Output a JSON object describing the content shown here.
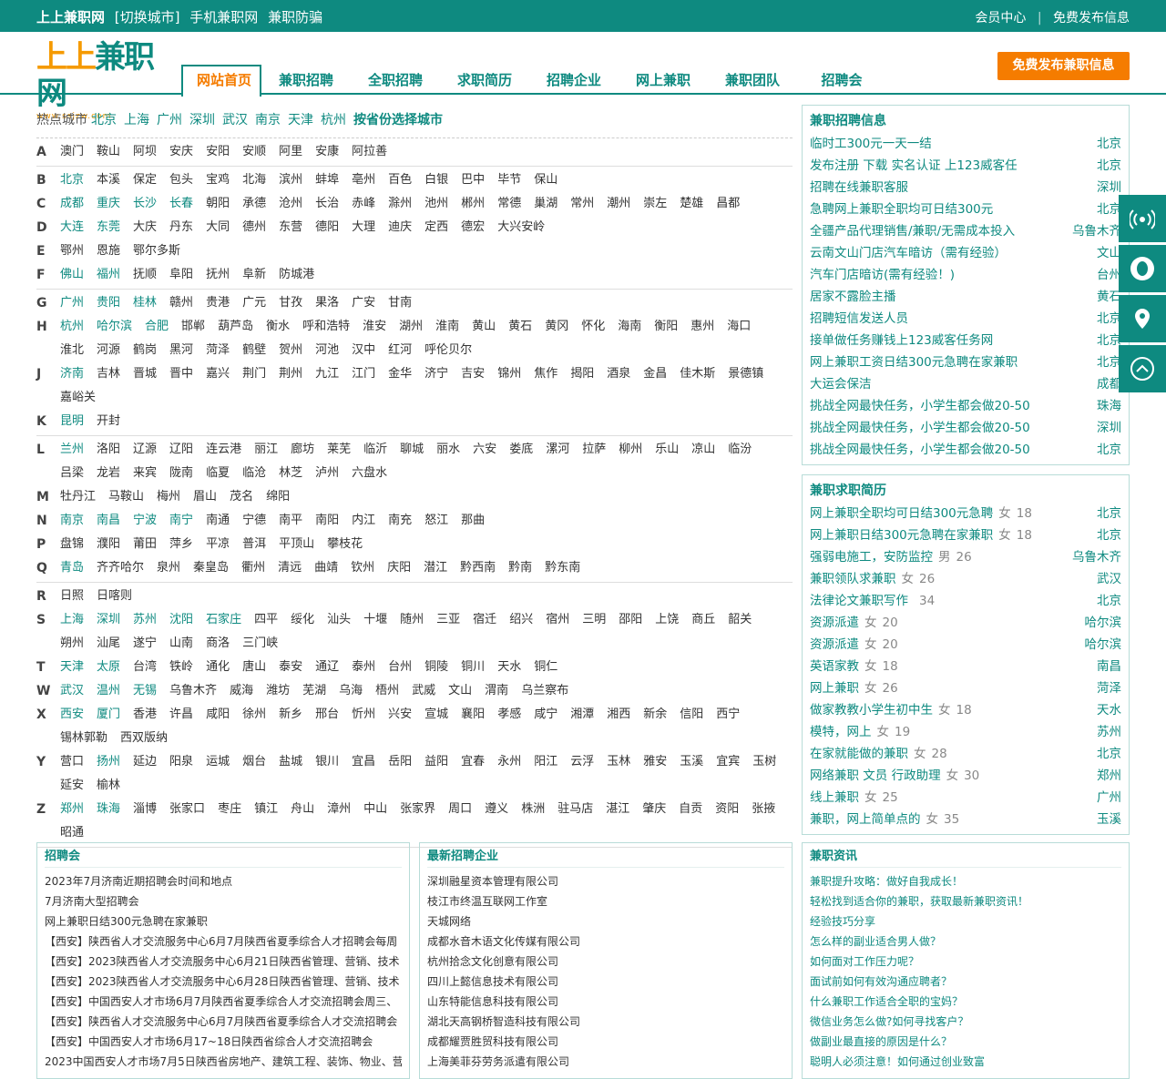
{
  "topbar": {
    "site": "上上兼职网",
    "switch": "[切换城市]",
    "mobile": "手机兼职网",
    "anti": "兼职防骗",
    "member": "会员中心",
    "sep": "|",
    "publish": "免费发布信息"
  },
  "logo": {
    "text_a": "上",
    "text_b": "上",
    "text_c": "兼职网",
    "url": "www.ssjzw.com"
  },
  "nav": [
    "网站首页",
    "兼职招聘",
    "全职招聘",
    "求职简历",
    "招聘企业",
    "网上兼职",
    "兼职团队",
    "招聘会"
  ],
  "publish_button": "免费发布兼职信息",
  "hot": {
    "label": "热点城市",
    "cities": [
      "北京",
      "上海",
      "广州",
      "深圳",
      "武汉",
      "南京",
      "天津",
      "杭州"
    ],
    "province": "按省份选择城市"
  },
  "groups": [
    [
      {
        "L": "A",
        "cities": [
          "澳门",
          "鞍山",
          "阿坝",
          "安庆",
          "安阳",
          "安顺",
          "阿里",
          "安康",
          "阿拉善"
        ],
        "hl": 0
      }
    ],
    [
      {
        "L": "B",
        "cities": [
          "北京",
          "本溪",
          "保定",
          "包头",
          "宝鸡",
          "北海",
          "滨州",
          "蚌埠",
          "亳州",
          "百色",
          "白银",
          "巴中",
          "毕节",
          "保山"
        ],
        "hl": 1
      },
      {
        "L": "C",
        "cities": [
          "成都",
          "重庆",
          "长沙",
          "长春",
          "朝阳",
          "承德",
          "沧州",
          "长治",
          "赤峰",
          "滁州",
          "池州",
          "郴州",
          "常德",
          "巢湖",
          "常州",
          "潮州",
          "崇左",
          "楚雄",
          "昌都"
        ],
        "hl": 4
      },
      {
        "L": "D",
        "cities": [
          "大连",
          "东莞",
          "大庆",
          "丹东",
          "大同",
          "德州",
          "东营",
          "德阳",
          "大理",
          "迪庆",
          "定西",
          "德宏",
          "大兴安岭"
        ],
        "hl": 2
      },
      {
        "L": "E",
        "cities": [
          "鄂州",
          "恩施",
          "鄂尔多斯"
        ],
        "hl": 0
      },
      {
        "L": "F",
        "cities": [
          "佛山",
          "福州",
          "抚顺",
          "阜阳",
          "抚州",
          "阜新",
          "防城港"
        ],
        "hl": 2
      }
    ],
    [
      {
        "L": "G",
        "cities": [
          "广州",
          "贵阳",
          "桂林",
          "赣州",
          "贵港",
          "广元",
          "甘孜",
          "果洛",
          "广安",
          "甘南"
        ],
        "hl": 3
      },
      {
        "L": "H",
        "cities": [
          "杭州",
          "哈尔滨",
          "合肥",
          "邯郸",
          "葫芦岛",
          "衡水",
          "呼和浩特",
          "淮安",
          "湖州",
          "淮南",
          "黄山",
          "黄石",
          "黄冈",
          "怀化",
          "海南",
          "衡阳",
          "惠州",
          "海口",
          "淮北",
          "河源",
          "鹤岗",
          "黑河",
          "菏泽",
          "鹤壁",
          "贺州",
          "河池",
          "汉中",
          "红河",
          "呼伦贝尔"
        ],
        "hl": 3
      },
      {
        "L": "J",
        "cities": [
          "济南",
          "吉林",
          "晋城",
          "晋中",
          "嘉兴",
          "荆门",
          "荆州",
          "九江",
          "江门",
          "金华",
          "济宁",
          "吉安",
          "锦州",
          "焦作",
          "揭阳",
          "酒泉",
          "金昌",
          "佳木斯",
          "景德镇",
          "嘉峪关"
        ],
        "hl": 1
      },
      {
        "L": "K",
        "cities": [
          "昆明",
          "开封"
        ],
        "hl": 1
      }
    ],
    [
      {
        "L": "L",
        "cities": [
          "兰州",
          "洛阳",
          "辽源",
          "辽阳",
          "连云港",
          "丽江",
          "廊坊",
          "莱芜",
          "临沂",
          "聊城",
          "丽水",
          "六安",
          "娄底",
          "漯河",
          "拉萨",
          "柳州",
          "乐山",
          "凉山",
          "临汾",
          "吕梁",
          "龙岩",
          "来宾",
          "陇南",
          "临夏",
          "临沧",
          "林芝",
          "泸州",
          "六盘水"
        ],
        "hl": 1
      },
      {
        "L": "M",
        "cities": [
          "牡丹江",
          "马鞍山",
          "梅州",
          "眉山",
          "茂名",
          "绵阳"
        ],
        "hl": 0
      },
      {
        "L": "N",
        "cities": [
          "南京",
          "南昌",
          "宁波",
          "南宁",
          "南通",
          "宁德",
          "南平",
          "南阳",
          "内江",
          "南充",
          "怒江",
          "那曲"
        ],
        "hl": 4
      },
      {
        "L": "P",
        "cities": [
          "盘锦",
          "濮阳",
          "莆田",
          "萍乡",
          "平凉",
          "普洱",
          "平顶山",
          "攀枝花"
        ],
        "hl": 0
      },
      {
        "L": "Q",
        "cities": [
          "青岛",
          "齐齐哈尔",
          "泉州",
          "秦皇岛",
          "衢州",
          "清远",
          "曲靖",
          "钦州",
          "庆阳",
          "潜江",
          "黔西南",
          "黔南",
          "黔东南"
        ],
        "hl": 1
      }
    ],
    [
      {
        "L": "R",
        "cities": [
          "日照",
          "日喀则"
        ],
        "hl": 0
      },
      {
        "L": "S",
        "cities": [
          "上海",
          "深圳",
          "苏州",
          "沈阳",
          "石家庄",
          "四平",
          "绥化",
          "汕头",
          "十堰",
          "随州",
          "三亚",
          "宿迁",
          "绍兴",
          "宿州",
          "三明",
          "邵阳",
          "上饶",
          "商丘",
          "韶关",
          "朔州",
          "汕尾",
          "遂宁",
          "山南",
          "商洛",
          "三门峡"
        ],
        "hl": 5
      },
      {
        "L": "T",
        "cities": [
          "天津",
          "太原",
          "台湾",
          "铁岭",
          "通化",
          "唐山",
          "泰安",
          "通辽",
          "泰州",
          "台州",
          "铜陵",
          "铜川",
          "天水",
          "铜仁"
        ],
        "hl": 2
      },
      {
        "L": "W",
        "cities": [
          "武汉",
          "温州",
          "无锡",
          "乌鲁木齐",
          "威海",
          "潍坊",
          "芜湖",
          "乌海",
          "梧州",
          "武威",
          "文山",
          "渭南",
          "乌兰察布"
        ],
        "hl": 3
      },
      {
        "L": "X",
        "cities": [
          "西安",
          "厦门",
          "香港",
          "许昌",
          "咸阳",
          "徐州",
          "新乡",
          "邢台",
          "忻州",
          "兴安",
          "宣城",
          "襄阳",
          "孝感",
          "咸宁",
          "湘潭",
          "湘西",
          "新余",
          "信阳",
          "西宁",
          "锡林郭勒",
          "西双版纳"
        ],
        "hl": 2
      },
      {
        "L": "Y",
        "cities": [
          "营口",
          "扬州",
          "延边",
          "阳泉",
          "运城",
          "烟台",
          "盐城",
          "银川",
          "宜昌",
          "岳阳",
          "益阳",
          "宜春",
          "永州",
          "阳江",
          "云浮",
          "玉林",
          "雅安",
          "玉溪",
          "宜宾",
          "玉树",
          "延安",
          "榆林"
        ],
        "hl": 0,
        "hlset": [
          1
        ]
      },
      {
        "L": "Z",
        "cities": [
          "郑州",
          "珠海",
          "淄博",
          "张家口",
          "枣庄",
          "镇江",
          "舟山",
          "漳州",
          "中山",
          "张家界",
          "周口",
          "遵义",
          "株洲",
          "驻马店",
          "湛江",
          "肇庆",
          "自贡",
          "资阳",
          "张掖",
          "昭通"
        ],
        "hl": 2
      }
    ]
  ],
  "jobs": {
    "title": "兼职招聘信息",
    "items": [
      {
        "t": "临时工300元一天一结",
        "c": "北京"
      },
      {
        "t": "发布注册 下载 实名认证 上123威客任",
        "c": "北京"
      },
      {
        "t": "招聘在线兼职客服",
        "c": "深圳"
      },
      {
        "t": "急聘网上兼职全职均可日结300元",
        "c": "北京"
      },
      {
        "t": "全疆产品代理销售/兼职/无需成本投入",
        "c": "乌鲁木齐"
      },
      {
        "t": "云南文山门店汽车暗访（需有经验）",
        "c": "文山"
      },
      {
        "t": "汽车门店暗访(需有经验！)",
        "c": "台州"
      },
      {
        "t": "居家不露脸主播",
        "c": "黄石"
      },
      {
        "t": "招聘短信发送人员",
        "c": "北京"
      },
      {
        "t": "接单做任务赚钱上123威客任务网",
        "c": "北京"
      },
      {
        "t": "网上兼职工资日结300元急聘在家兼职",
        "c": "北京"
      },
      {
        "t": "大运会保洁",
        "c": "成都"
      },
      {
        "t": "挑战全网最快任务，小学生都会做20-50",
        "c": "珠海"
      },
      {
        "t": "挑战全网最快任务，小学生都会做20-50",
        "c": "深圳"
      },
      {
        "t": "挑战全网最快任务，小学生都会做20-50",
        "c": "北京"
      }
    ]
  },
  "resumes": {
    "title": "兼职求职简历",
    "items": [
      {
        "t": "网上兼职全职均可日结300元急聘",
        "g": "女",
        "a": "18",
        "c": "北京"
      },
      {
        "t": "网上兼职日结300元急聘在家兼职",
        "g": "女",
        "a": "18",
        "c": "北京"
      },
      {
        "t": "强弱电施工，安防监控",
        "g": "男",
        "a": "26",
        "c": "乌鲁木齐"
      },
      {
        "t": "兼职领队求兼职",
        "g": "女",
        "a": "26",
        "c": "武汉"
      },
      {
        "t": "法律论文兼职写作",
        "g": "",
        "a": "34",
        "c": "北京"
      },
      {
        "t": "资源派遣",
        "g": "女",
        "a": "20",
        "c": "哈尔滨"
      },
      {
        "t": "资源派遣",
        "g": "女",
        "a": "20",
        "c": "哈尔滨"
      },
      {
        "t": "英语家教",
        "g": "女",
        "a": "18",
        "c": "南昌"
      },
      {
        "t": "网上兼职",
        "g": "女",
        "a": "26",
        "c": "菏泽"
      },
      {
        "t": "做家教教小学生初中生",
        "g": "女",
        "a": "18",
        "c": "天水"
      },
      {
        "t": "模特，网上",
        "g": "女",
        "a": "19",
        "c": "苏州"
      },
      {
        "t": "在家就能做的兼职",
        "g": "女",
        "a": "28",
        "c": "北京"
      },
      {
        "t": "网络兼职 文员 行政助理",
        "g": "女",
        "a": "30",
        "c": "郑州"
      },
      {
        "t": "线上兼职",
        "g": "女",
        "a": "25",
        "c": "广州"
      },
      {
        "t": "兼职，网上简单点的",
        "g": "女",
        "a": "35",
        "c": "玉溪"
      }
    ]
  },
  "fairs": {
    "title": "招聘会",
    "items": [
      "2023年7月济南近期招聘会时间和地点",
      "7月济南大型招聘会",
      "网上兼职日结300元急聘在家兼职",
      "【西安】陕西省人才交流服务中心6月7月陕西省夏季综合人才招聘会每周",
      "【西安】2023陕西省人才交流服务中心6月21日陕西省管理、营销、技术",
      "【西安】2023陕西省人才交流服务中心6月28日陕西省管理、营销、技术",
      "【西安】中国西安人才市场6月7月陕西省夏季综合人才交流招聘会周三、",
      "【西安】陕西省人才交流服务中心6月7月陕西省夏季综合人才交流招聘会",
      "【西安】中国西安人才市场6月17~18日陕西省综合人才交流招聘会",
      "2023中国西安人才市场7月5日陕西省房地产、建筑工程、装饰、物业、营"
    ]
  },
  "companies": {
    "title": "最新招聘企业",
    "items": [
      "深圳融星资本管理有限公司",
      "枝江市终温互联网工作室",
      "天城网络",
      "成都水音木语文化传媒有限公司",
      "杭州拾念文化创意有限公司",
      "四川上懿信息技术有限公司",
      "山东特能信息科技有限公司",
      "湖北天高钢桥智造科技有限公司",
      "成都耀贾胜贸科技有限公司",
      "上海美菲芬劳务派遣有限公司"
    ]
  },
  "news": {
    "title": "兼职资讯",
    "items": [
      "兼职提升攻略：做好自我成长！",
      "轻松找到适合你的兼职，获取最新兼职资讯！",
      "经验技巧分享",
      "怎么样的副业适合男人做？",
      "如何面对工作压力呢？",
      "面试前如何有效沟通应聘者？",
      "什么兼职工作适合全职的宝妈？",
      "微信业务怎么做?如何寻找客户？",
      "做副业最直接的原因是什么？",
      "聪明人必须注意！如何通过创业致富"
    ]
  },
  "side_icons": [
    "signal-icon",
    "qq-icon",
    "location-icon",
    "back-to-top-icon"
  ],
  "colors": {
    "brand": "#0e8a80",
    "accent": "#f57c00"
  }
}
